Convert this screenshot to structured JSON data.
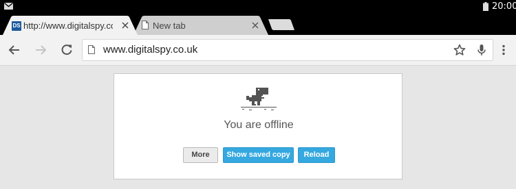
{
  "status_bar": {
    "time": "20:00",
    "notification_icon": "gmail-icon",
    "battery_icon": "battery-icon"
  },
  "tabs": [
    {
      "title": "http://www.digitalspy.co.uk",
      "favicon_text": "DS",
      "active": true
    },
    {
      "title": "New tab",
      "favicon": "page-icon",
      "active": false
    }
  ],
  "toolbar": {
    "url": "www.digitalspy.co.uk"
  },
  "offline": {
    "title": "You are offline",
    "buttons": {
      "more": "More",
      "saved_copy": "Show saved copy",
      "reload": "Reload"
    }
  },
  "colors": {
    "accent_button": "#35a8e0",
    "page_background": "#e6e6e6",
    "status_bar": "#000000"
  }
}
